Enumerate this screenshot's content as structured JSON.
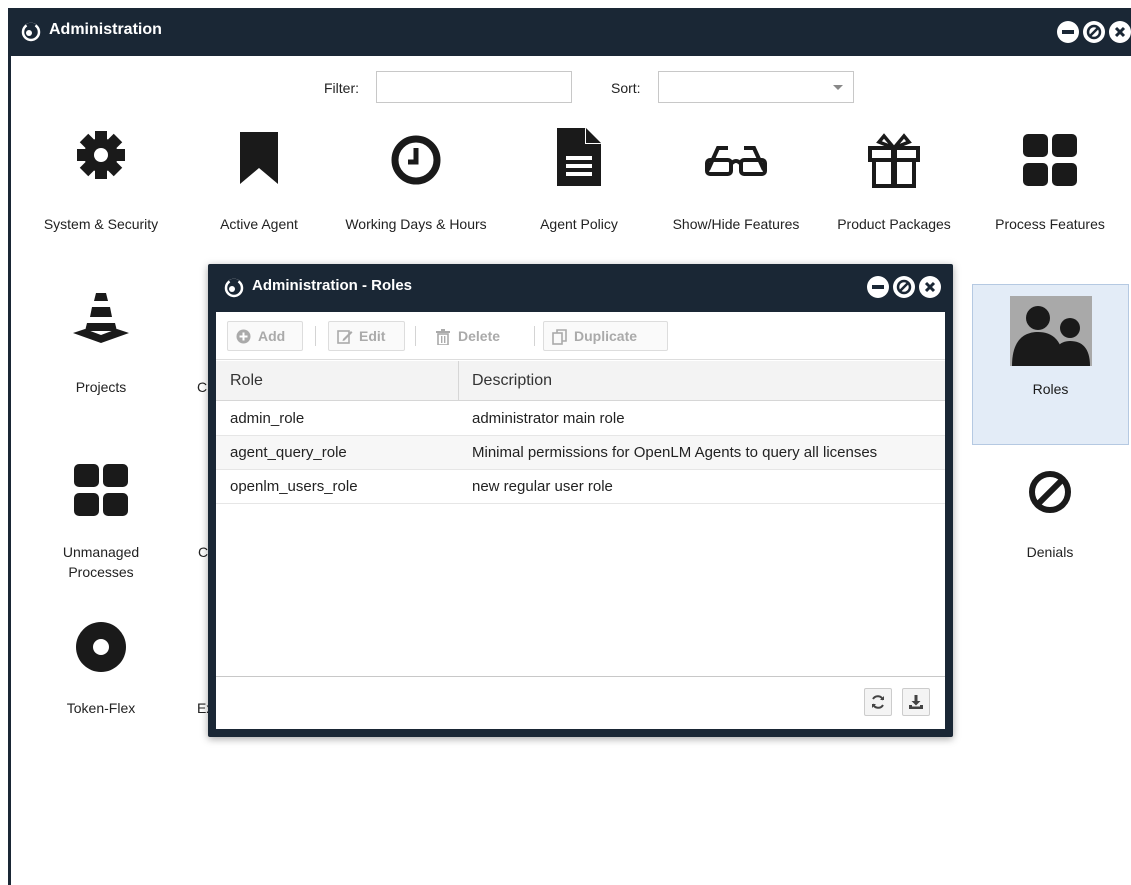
{
  "window": {
    "title": "Administration"
  },
  "filter": {
    "label": "Filter:",
    "value": ""
  },
  "sort": {
    "label": "Sort:",
    "value": ""
  },
  "tiles": [
    {
      "label": "System & Security",
      "icon": "gear-icon"
    },
    {
      "label": "Active Agent",
      "icon": "bookmark-icon"
    },
    {
      "label": "Working Days & Hours",
      "icon": "clock-icon"
    },
    {
      "label": "Agent Policy",
      "icon": "document-icon"
    },
    {
      "label": "Show/Hide Features",
      "icon": "glasses-icon"
    },
    {
      "label": "Product Packages",
      "icon": "gift-icon"
    },
    {
      "label": "Process Features",
      "icon": "grid-icon"
    },
    {
      "label": "Projects",
      "icon": "traffic-cone-icon"
    },
    {
      "label": "Cle",
      "icon": ""
    },
    {
      "label": "Roles",
      "icon": "users-icon"
    },
    {
      "label": "Unmanaged Processes",
      "icon": "grid-icon"
    },
    {
      "label": "C",
      "icon": ""
    },
    {
      "label": "Denials",
      "icon": "ban-icon"
    },
    {
      "label": "Token-Flex",
      "icon": "disc-icon"
    },
    {
      "label": "Ext",
      "icon": ""
    }
  ],
  "dialog": {
    "title": "Administration - Roles",
    "toolbar": {
      "add": "Add",
      "edit": "Edit",
      "delete": "Delete",
      "duplicate": "Duplicate"
    },
    "columns": {
      "role": "Role",
      "description": "Description"
    },
    "rows": [
      {
        "role": "admin_role",
        "description": "administrator main role"
      },
      {
        "role": "agent_query_role",
        "description": "Minimal permissions for OpenLM Agents to query all licenses"
      },
      {
        "role": "openlm_users_role",
        "description": "new regular user role"
      }
    ]
  },
  "colors": {
    "titlebar": "#1a2735",
    "selected_tile": "#e3ecf7"
  }
}
